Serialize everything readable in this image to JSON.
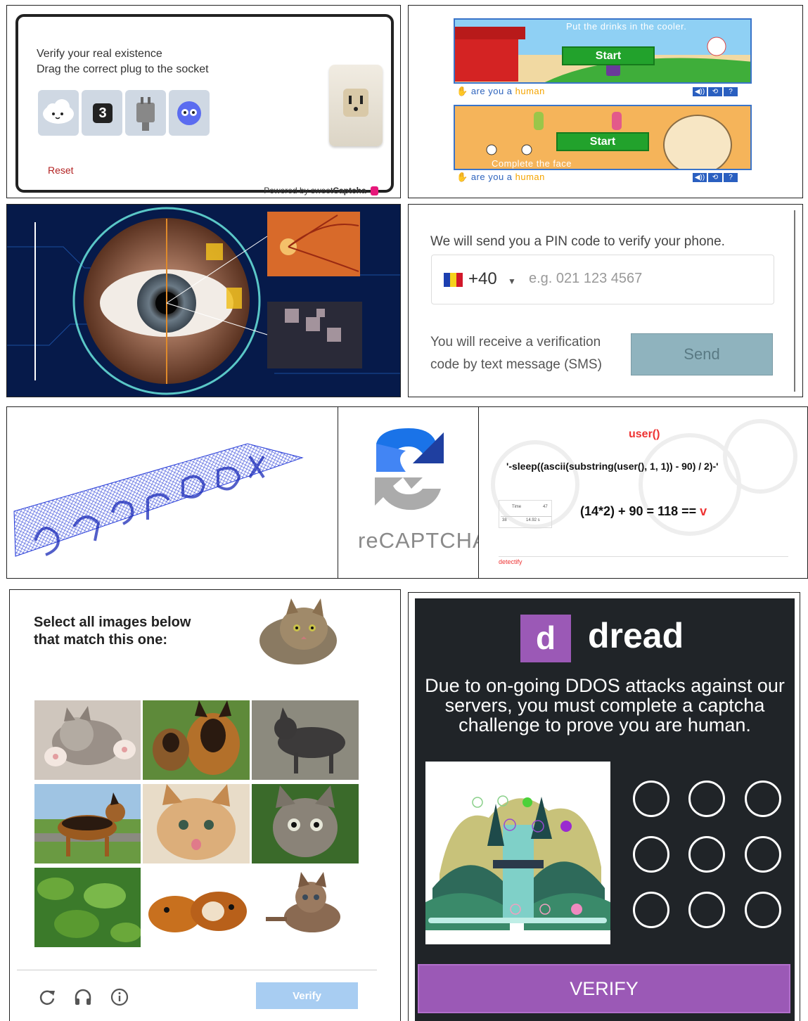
{
  "sweetcaptcha": {
    "line1": "Verify your real existence",
    "line2": "Drag the correct plug to the socket",
    "tile_number": "3",
    "reset": "Reset",
    "powered_prefix": "Powered by sweet",
    "powered_brand": "Captcha"
  },
  "areyouahuman": {
    "game1_caption": "Put the drinks in the cooler.",
    "game2_caption": "Complete the face",
    "start": "Start",
    "brand_prefix": "are you a ",
    "brand_suffix": "human",
    "controls": [
      "◀))",
      "⟲",
      "?"
    ]
  },
  "pin": {
    "title": "We will send you a PIN code to verify your phone.",
    "country_code": "+40",
    "placeholder": "e.g. 021 123 4567",
    "info": "You will receive a verification code by text message (SMS)",
    "send": "Send"
  },
  "recaptcha": {
    "label": "reCAPTCHA"
  },
  "sqli": {
    "title": "user()",
    "payload": "'-sleep((ascii(substring(user(), 1, 1)) - 90) / 2)-'",
    "equation": "(14*2) + 90 = 118 == ",
    "char": "v",
    "table_header": "Time",
    "table_num": "47",
    "table_row_id": "38",
    "table_row_val": "14.92 s",
    "brand": "detectify"
  },
  "imagecaptcha": {
    "instruction_line1": "Select all images below",
    "instruction_line2": "that match this one:",
    "verify": "Verify"
  },
  "dread": {
    "logo_letter": "d",
    "brand": "dread",
    "message": "Due to on-going DDOS attacks against our servers, you must complete a captcha challenge to prove you are human.",
    "verify": "VERIFY"
  },
  "colors": {
    "dread_purple": "#9b59b6",
    "start_green": "#22a22c",
    "recaptcha_blue": "#1a73e8",
    "reset_red": "#b32222"
  }
}
